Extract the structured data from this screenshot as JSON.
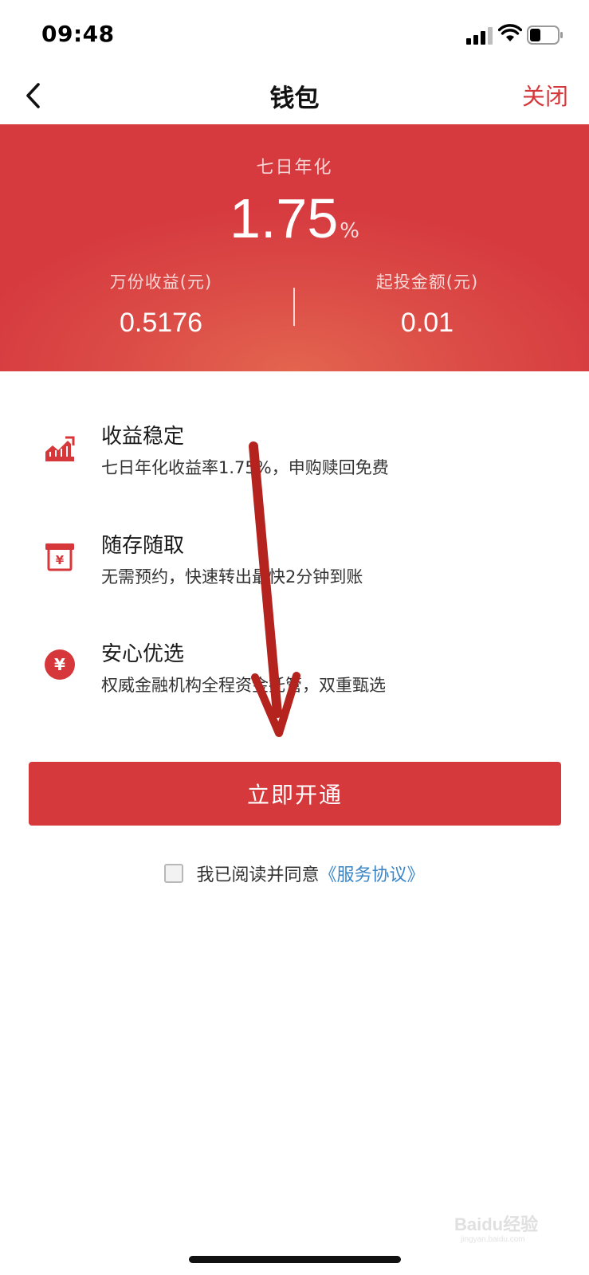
{
  "status_bar": {
    "time": "09:48"
  },
  "nav": {
    "title": "钱包",
    "close_label": "关闭"
  },
  "hero": {
    "caption": "七日年化",
    "rate": "1.75",
    "rate_unit": "%",
    "left_label": "万份收益(元)",
    "left_value": "0.5176",
    "right_label": "起投金额(元)",
    "right_value": "0.01"
  },
  "features": [
    {
      "title": "收益稳定",
      "desc": "七日年化收益率1.75%，申购赎回免费",
      "icon": "chart-up-icon"
    },
    {
      "title": "随存随取",
      "desc": "无需预约，快速转出最快2分钟到账",
      "icon": "yuan-box-icon"
    },
    {
      "title": "安心优选",
      "desc": "权威金融机构全程资金托管，双重甄选",
      "icon": "yuan-circle-icon"
    }
  ],
  "cta": {
    "label": "立即开通"
  },
  "agreement": {
    "prefix": "我已阅读并同意",
    "link": "《服务协议》",
    "checked": false
  },
  "watermark": {
    "text": "Baidu经验",
    "subtext": "jingyan.baidu.com"
  },
  "colors": {
    "brand_red": "#d5393c",
    "link_blue": "#3a86c8",
    "annotation_arrow": "#b5231f"
  }
}
